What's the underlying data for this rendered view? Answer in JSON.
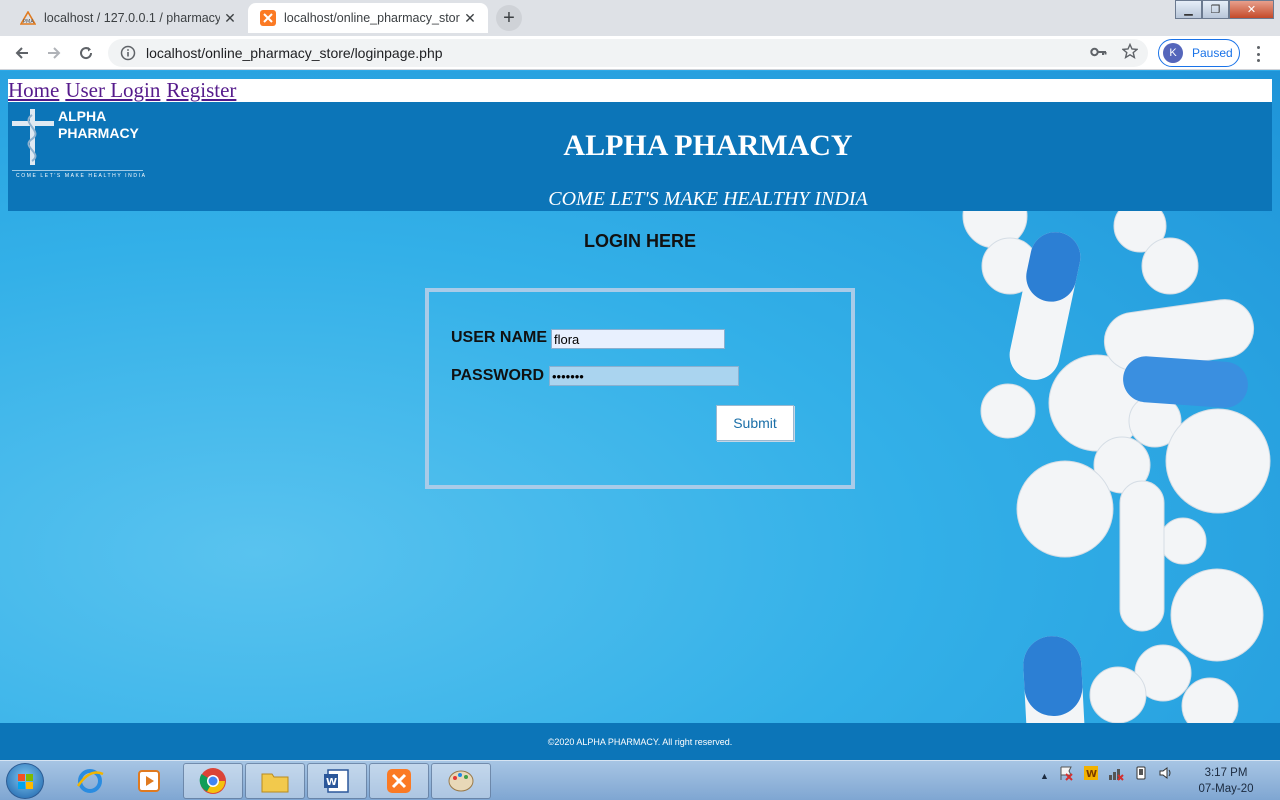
{
  "browser": {
    "tabs": [
      {
        "title": "localhost / 127.0.0.1 / pharmacy /",
        "favicon": "phpmyadmin-icon",
        "active": false
      },
      {
        "title": "localhost/online_pharmacy_store",
        "favicon": "xampp-icon",
        "active": true
      }
    ],
    "url": "localhost/online_pharmacy_store/loginpage.php",
    "profile": {
      "initial": "K",
      "status": "Paused"
    }
  },
  "nav": {
    "links": [
      {
        "label": "Home"
      },
      {
        "label": "User Login"
      },
      {
        "label": "Register"
      }
    ]
  },
  "banner": {
    "logo_name_line1": "ALPHA",
    "logo_name_line2": "PHARMACY",
    "logo_tagline": "COME LET'S MAKE HEALTHY INDIA",
    "title": "ALPHA PHARMACY",
    "subtitle": "COME LET'S MAKE HEALTHY INDIA"
  },
  "login": {
    "heading": "LOGIN HERE",
    "username_label": "USER NAME",
    "username_value": "flora",
    "password_label": "PASSWORD",
    "password_value": "•••••••",
    "submit_label": "Submit"
  },
  "footer": {
    "text": "©2020 ALPHA PHARMACY. All right reserved."
  },
  "taskbar": {
    "clock_time": "3:17 PM",
    "clock_date": "07-May-20"
  },
  "colors": {
    "banner": "#0c75b8",
    "page_bg": "#2ea8e6",
    "nav_link": "#551a8b"
  }
}
